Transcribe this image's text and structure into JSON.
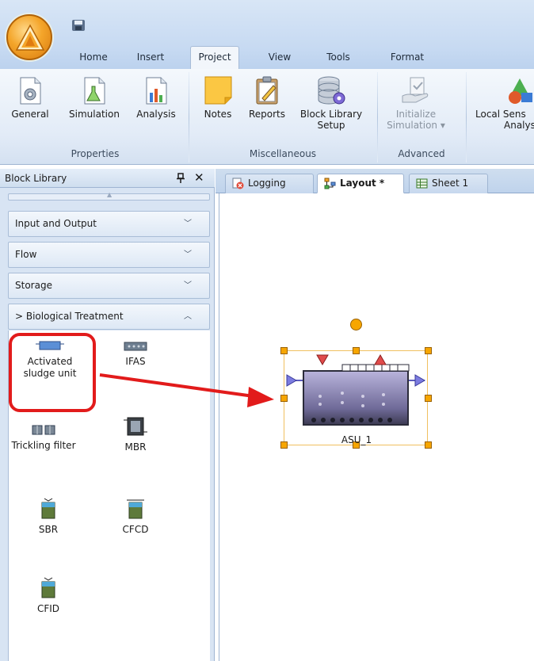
{
  "ribbon": {
    "tabs": [
      "Home",
      "Insert",
      "Project",
      "View",
      "Tools",
      "Format"
    ],
    "active_tab": "Project",
    "groups": {
      "properties": {
        "label": "Properties",
        "buttons": [
          "General",
          "Simulation",
          "Analysis"
        ]
      },
      "miscellaneous": {
        "label": "Miscellaneous",
        "notes": "Notes",
        "reports": "Reports",
        "block_library_line1": "Block Library",
        "block_library_line2": "Setup"
      },
      "advanced": {
        "label": "Advanced",
        "initialize_line1": "Initialize",
        "initialize_line2": "Simulation ▾"
      },
      "local_sensitivity": {
        "line1": "Local Sens",
        "line2": "Analysi"
      }
    }
  },
  "block_library": {
    "title": "Block Library",
    "pin_glyph": "ᵖ",
    "close_glyph": "✕",
    "categories": [
      "Input and Output",
      "Flow",
      "Storage",
      "> Biological Treatment"
    ],
    "blocks": {
      "asu_line1": "Activated",
      "asu_line2": "sludge unit",
      "ifas": "IFAS",
      "trickling": "Trickling filter",
      "mbr": "MBR",
      "sbr": "SBR",
      "cfcd": "CFCD",
      "cfid": "CFID"
    }
  },
  "documents": {
    "tabs": [
      "Logging",
      "Layout *",
      "Sheet 1"
    ],
    "active_tab": "Layout *"
  },
  "canvas": {
    "block_label": "ASU_1"
  },
  "colors": {
    "highlight": "#e21b1b",
    "selection_handle": "#f7a600"
  }
}
